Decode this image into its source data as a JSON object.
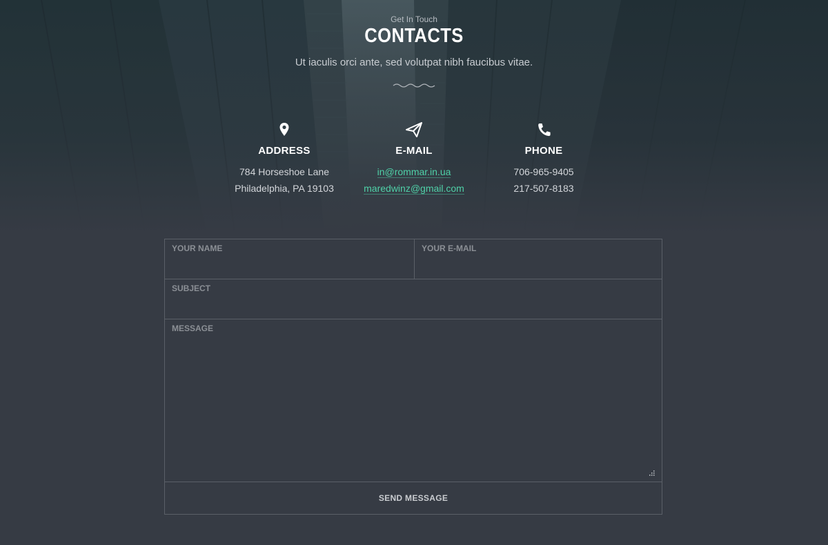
{
  "header": {
    "eyebrow": "Get In Touch",
    "title": "CONTACTS",
    "subtitle": "Ut iaculis orci ante, sed volutpat nibh faucibus vitae."
  },
  "contacts": {
    "address": {
      "icon": "map-pin-icon",
      "heading": "ADDRESS",
      "line1": "784 Horseshoe Lane",
      "line2": "Philadelphia, PA 19103"
    },
    "email": {
      "icon": "paper-plane-icon",
      "heading": "E-MAIL",
      "line1": "in@rommar.in.ua",
      "line2": "maredwinz@gmail.com"
    },
    "phone": {
      "icon": "phone-icon",
      "heading": "PHONE",
      "line1": "706-965-9405",
      "line2": "217-507-8183"
    }
  },
  "form": {
    "name_placeholder": "YOUR NAME",
    "email_placeholder": "YOUR E-MAIL",
    "subject_placeholder": "SUBJECT",
    "message_placeholder": "MESSAGE",
    "submit_label": "SEND MESSAGE"
  },
  "colors": {
    "accent": "#4fd1a8",
    "background": "#363b44"
  }
}
